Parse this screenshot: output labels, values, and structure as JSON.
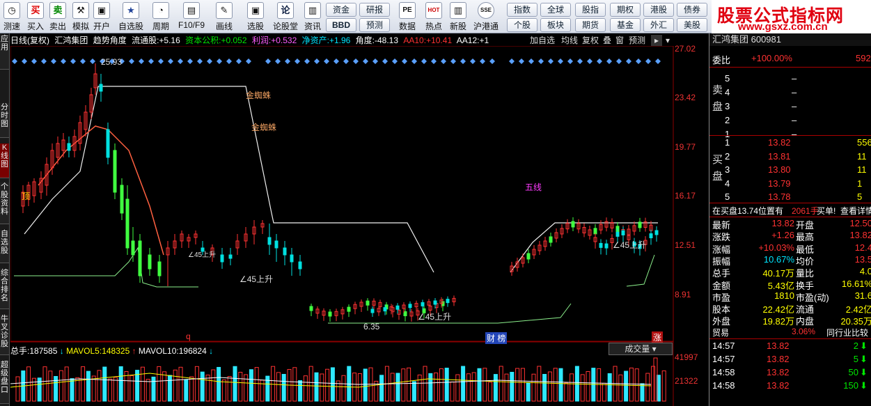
{
  "toolbar": {
    "buttons": [
      {
        "label": "测速",
        "icon": "speed-icon",
        "glyph": "◷"
      },
      {
        "label": "买入",
        "icon": "buy-icon",
        "glyph": "买"
      },
      {
        "label": "卖出",
        "icon": "sell-icon",
        "glyph": "卖"
      },
      {
        "label": "模拟",
        "icon": "simulate-icon",
        "glyph": "⚒"
      },
      {
        "label": "开户",
        "icon": "lock-icon",
        "glyph": "🔒"
      },
      {
        "label": "自选股",
        "icon": "favorites-icon",
        "glyph": "★"
      },
      {
        "label": "周期",
        "icon": "clock-icon",
        "glyph": "⏱"
      },
      {
        "label": "F10/F9",
        "icon": "f10-icon",
        "glyph": "▤"
      },
      {
        "label": "画线",
        "icon": "pen-icon",
        "glyph": "✎"
      },
      {
        "label": "选股",
        "icon": "screen-icon",
        "glyph": "▣"
      },
      {
        "label": "论股堂",
        "icon": "forum-icon",
        "glyph": "论"
      },
      {
        "label": "资讯",
        "icon": "news-icon",
        "glyph": "▥"
      }
    ],
    "mid": [
      {
        "label": "资金"
      },
      {
        "label": "研报"
      },
      {
        "label": "BBD"
      },
      {
        "label": "预测"
      }
    ],
    "mid2": [
      {
        "label": "数据",
        "glyph": "PE"
      },
      {
        "label": "热点",
        "glyph": "HOT"
      },
      {
        "label": "新股",
        "glyph": "▥"
      },
      {
        "label": "沪港通",
        "glyph": "SSE"
      }
    ],
    "grid": [
      [
        "指数",
        "全球",
        "股指",
        "期权",
        "港股",
        "债券"
      ],
      [
        "个股",
        "板块",
        "期货",
        "基金",
        "外汇",
        "美股"
      ]
    ]
  },
  "brand": {
    "title": "股票公式指标网",
    "url": "www.gsxz.com.cn"
  },
  "lefttabs": [
    "应用",
    "分时图",
    "K线图",
    "个股资料",
    "自选股",
    "综合排名",
    "牛叉诊股",
    "超级盘口"
  ],
  "info": {
    "period": "日线(复权)",
    "name": "汇鸿集团",
    "indicator": "趋势角度",
    "float": "流通股:",
    "float_v": "+5.16",
    "reserve": "资本公积:",
    "reserve_v": "+0.052",
    "profit": "利润:",
    "profit_v": "+0.532",
    "asset": "净资产:",
    "asset_v": "+1.96",
    "angle": "角度:",
    "angle_v": "-48.13",
    "aa10": "AA10:",
    "aa10_v": "+10.41",
    "aa12": "AA12:",
    "aa12_v": "+1"
  },
  "right_tools": [
    "加自选",
    "均线",
    "复权",
    "叠",
    "窗",
    "预测"
  ],
  "yaxis": [
    "27.02",
    "23.42",
    "19.77",
    "16.17",
    "12.51",
    "8.91"
  ],
  "annotations": {
    "high": "25.93",
    "low": "6.35",
    "spider1": "金蜘蛛",
    "spider2": "金蜘蛛",
    "wu": "五线",
    "up1": "∠45上升",
    "up2": "∠45上升",
    "up3": "∠45上升",
    "up4": "∠45上升",
    "top": "顶",
    "q": "q",
    "cb": "财 榜",
    "zhang": "涨"
  },
  "volume": {
    "total_label": "总手:",
    "total": "187585",
    "mav5_label": "MAVOL5:",
    "mav5": "148325",
    "mav10_label": "MAVOL10:",
    "mav10": "196824",
    "deal": "成交量",
    "v1": "41997",
    "v2": "21322"
  },
  "panel": {
    "title": "汇鸿集团 600981",
    "weibi_label": "委比",
    "weibi": "+100.00%",
    "weibi_r": "592",
    "sell_label": "卖盘",
    "buy_label": "买盘",
    "sells": [
      {
        "n": "5",
        "p": "–"
      },
      {
        "n": "4",
        "p": "–"
      },
      {
        "n": "3",
        "p": "–"
      },
      {
        "n": "2",
        "p": "–"
      },
      {
        "n": "1",
        "p": "–"
      }
    ],
    "buys": [
      {
        "n": "1",
        "p": "13.82",
        "v": "556"
      },
      {
        "n": "2",
        "p": "13.81",
        "v": "11"
      },
      {
        "n": "3",
        "p": "13.80",
        "v": "11"
      },
      {
        "n": "4",
        "p": "13.79",
        "v": "1"
      },
      {
        "n": "5",
        "p": "13.78",
        "v": "5"
      }
    ],
    "notice": "在买盘13.74位置有",
    "notice_v": "2061手",
    "notice_a": "买单!",
    "notice_b": "查看详情",
    "stats": [
      [
        "最新",
        "13.82",
        "开盘",
        "12.50"
      ],
      [
        "涨跌",
        "+1.26",
        "最高",
        "13.82"
      ],
      [
        "涨幅",
        "+10.03%",
        "最低",
        "12.4"
      ],
      [
        "振幅",
        "10.67%",
        "均价",
        "13.5"
      ],
      [
        "总手",
        "40.17万",
        "量比",
        "4.0"
      ],
      [
        "金额",
        "5.43亿",
        "换手",
        "16.61%"
      ],
      [
        "市盈",
        "1810",
        "市盈(动)",
        "31.6"
      ],
      [
        "股本",
        "22.42亿",
        "流通",
        "2.42亿"
      ],
      [
        "外盘",
        "19.82万",
        "内盘",
        "20.35万"
      ]
    ],
    "trade_label": "贸易",
    "trade_v": "3.06%",
    "compare": "同行业比较",
    "ticks": [
      [
        "14:57",
        "13.82",
        "2"
      ],
      [
        "14:57",
        "13.82",
        "5"
      ],
      [
        "14:58",
        "13.82",
        "50"
      ],
      [
        "14:58",
        "13.82",
        "150"
      ]
    ]
  }
}
